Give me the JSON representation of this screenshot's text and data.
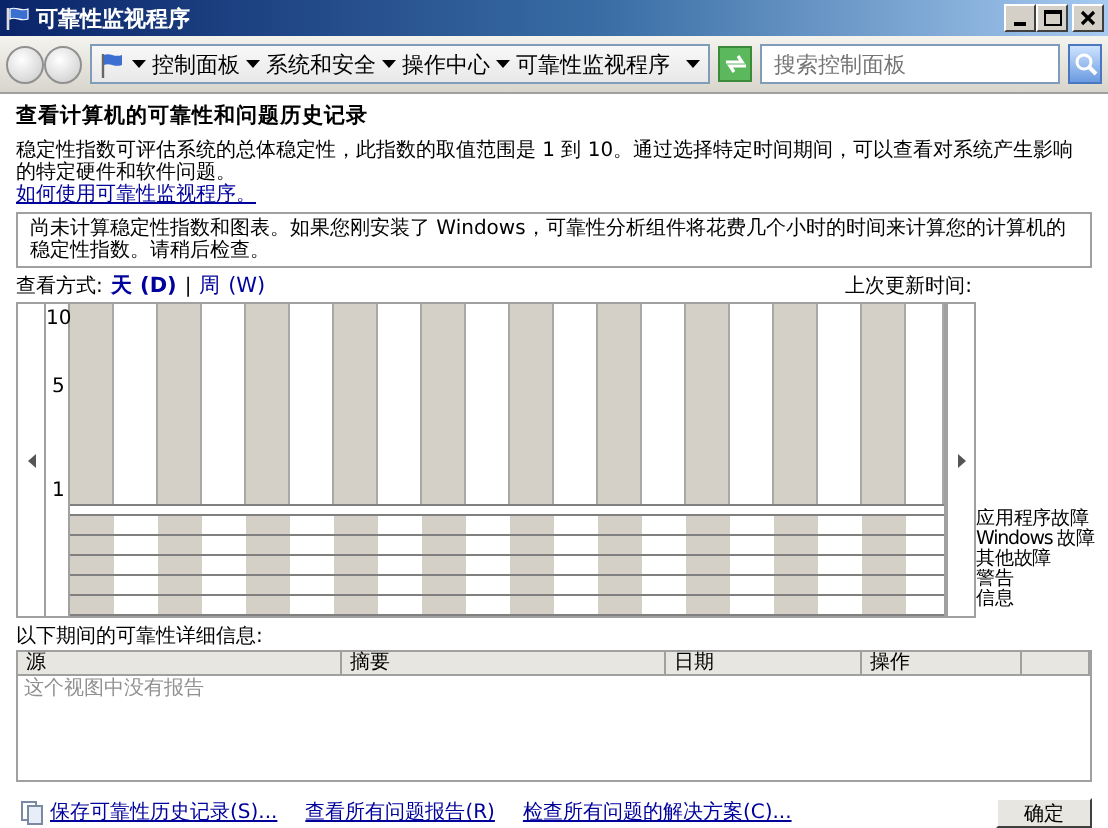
{
  "window": {
    "title": "可靠性监视程序"
  },
  "address_bar": {
    "breadcrumbs": [
      "控制面板",
      "系统和安全",
      "操作中心",
      "可靠性监视程序"
    ]
  },
  "search": {
    "placeholder": "搜索控制面板"
  },
  "heading": "查看计算机的可靠性和问题历史记录",
  "description": "稳定性指数可评估系统的总体稳定性，此指数的取值范围是 1 到 10。通过选择特定时间期间，可以查看对系统产生影响的特定硬件和软件问题。",
  "help_link": "如何使用可靠性监视程序。",
  "notice": "尚未计算稳定性指数和图表。如果您刚安装了 Windows，可靠性分析组件将花费几个小时的时间来计算您的计算机的稳定性指数。请稍后检查。",
  "view": {
    "label": "查看方式:",
    "separator": "|",
    "options": [
      {
        "label": "天 (D)",
        "selected": true
      },
      {
        "label": "周 (W)",
        "selected": false
      }
    ]
  },
  "last_updated": "上次更新时间:",
  "chart": {
    "y_labels": [
      "10",
      "5",
      "1"
    ],
    "event_rows": [
      "应用程序故障",
      "Windows 故障",
      "其他故障",
      "警告",
      "信息"
    ]
  },
  "details": {
    "label": "以下期间的可靠性详细信息:",
    "columns": [
      "源",
      "摘要",
      "日期",
      "操作"
    ],
    "empty_message": "这个视图中没有报告"
  },
  "footer": {
    "links": [
      {
        "label": "保存可靠性历史记录(S)...",
        "icon": true
      },
      {
        "label": "查看所有问题报告(R)",
        "icon": false
      },
      {
        "label": "检查所有问题的解决方案(C)...",
        "icon": false
      }
    ],
    "ok_button": "确定"
  }
}
